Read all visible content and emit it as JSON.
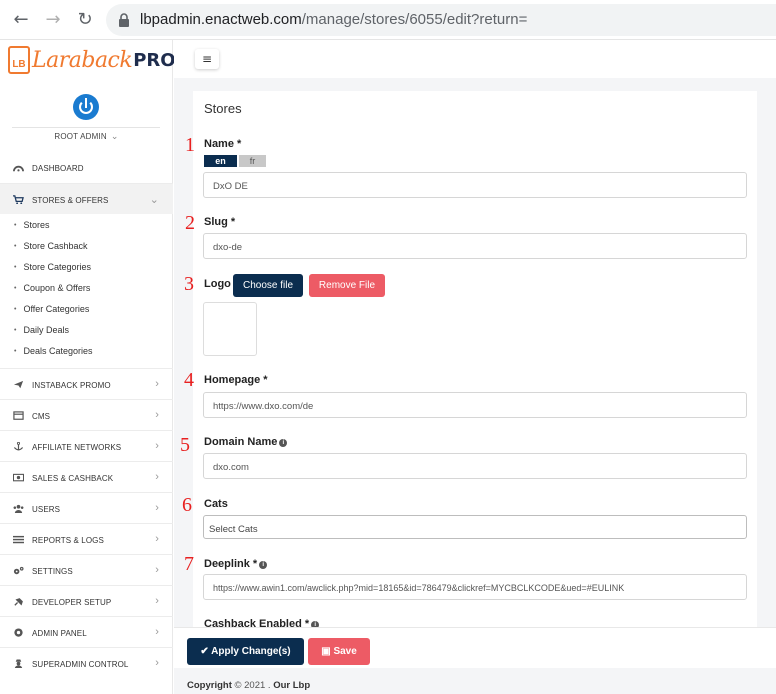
{
  "browser": {
    "url_host": "lbpadmin.enactweb.com",
    "url_path": "/manage/stores/6055/edit?return="
  },
  "sidebar": {
    "logo_main": "Laraback",
    "logo_pro": "PRO",
    "logo_box": "LB",
    "user": "ROOT ADMIN",
    "items": [
      {
        "label": "DASHBOARD",
        "icon": "dashboard-icon"
      },
      {
        "label": "STORES & OFFERS",
        "icon": "cart-icon",
        "expanded": true
      },
      {
        "label": "INSTABACK PROMO",
        "icon": "plane-icon"
      },
      {
        "label": "CMS",
        "icon": "window-icon"
      },
      {
        "label": "AFFILIATE NETWORKS",
        "icon": "anchor-icon"
      },
      {
        "label": "SALES & CASHBACK",
        "icon": "money-icon"
      },
      {
        "label": "USERS",
        "icon": "users-icon"
      },
      {
        "label": "REPORTS & LOGS",
        "icon": "list-icon"
      },
      {
        "label": "SETTINGS",
        "icon": "cogs-icon"
      },
      {
        "label": "DEVELOPER SETUP",
        "icon": "plug-icon"
      },
      {
        "label": "ADMIN PANEL",
        "icon": "shield-icon"
      },
      {
        "label": "SUPERADMIN CONTROL",
        "icon": "user-secret-icon"
      }
    ],
    "subitems": [
      "Stores",
      "Store Cashback",
      "Store Categories",
      "Coupon & Offers",
      "Offer Categories",
      "Daily Deals",
      "Deals Categories"
    ]
  },
  "form": {
    "title": "Stores",
    "name_label": "Name *",
    "lang_en": "en",
    "lang_fr": "fr",
    "name_value": "DxO DE",
    "slug_label": "Slug *",
    "slug_value": "dxo-de",
    "logo_label": "Logo",
    "choose_file": "Choose file",
    "remove_file": "Remove File",
    "homepage_label": "Homepage *",
    "homepage_value": "https://www.dxo.com/de",
    "domain_label": "Domain Name",
    "domain_value": "dxo.com",
    "cats_label": "Cats",
    "cats_placeholder": "Select Cats",
    "deeplink_label": "Deeplink *",
    "deeplink_value": "https://www.awin1.com/awclick.php?mid=18165&id=786479&clickref=MYCBCLKCODE&ued=#EULINK",
    "cashback_label": "Cashback Enabled *"
  },
  "annotations": [
    "1",
    "2",
    "3",
    "4",
    "5",
    "6",
    "7"
  ],
  "footer": {
    "apply": "Apply Change(s)",
    "save": "Save",
    "copyright_prefix": "Copyright",
    "copyright_rest": "© 2021 .",
    "copyright_name": "Our Lbp"
  }
}
